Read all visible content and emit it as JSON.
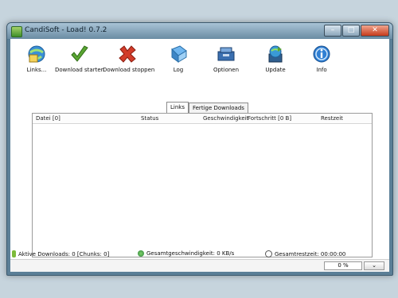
{
  "window": {
    "title": "CandiSoft - Load! 0.7.2",
    "controls": {
      "minimize": "–",
      "maximize": "□",
      "close": "✕"
    }
  },
  "toolbar": {
    "items": [
      {
        "label": "Links...",
        "icon": "links-globe-icon"
      },
      {
        "label": "Download starten",
        "icon": "checkmark-icon"
      },
      {
        "label": "Download stoppen",
        "icon": "red-x-icon"
      },
      {
        "label": "Log",
        "icon": "log-book-icon"
      },
      {
        "label": "Optionen",
        "icon": "options-toolbox-icon"
      },
      {
        "label": "Update",
        "icon": "update-globe-icon"
      },
      {
        "label": "Info",
        "icon": "info-icon"
      }
    ]
  },
  "tabs": [
    {
      "label": "Links",
      "active": true
    },
    {
      "label": "Fertige Downloads",
      "active": false
    }
  ],
  "grid": {
    "columns": [
      "Datei [0]",
      "Status",
      "Geschwindigkeit",
      "Fortschritt [0 B]",
      "Restzeit"
    ],
    "rows": []
  },
  "status": {
    "active_downloads": "Aktive Downloads: 0 [Chunks: 0]",
    "total_speed": "Gesamtgeschwindigkeit: 0 KB/s",
    "total_remaining": "Gesamtrestzeit: 00:00:00"
  },
  "bottom": {
    "progress": "0 %",
    "dropdown_glyph": "⌄"
  },
  "colors": {
    "accent": "#4f758f",
    "green": "#5aa532",
    "red": "#d23c2a",
    "blue": "#2f7fd3"
  }
}
